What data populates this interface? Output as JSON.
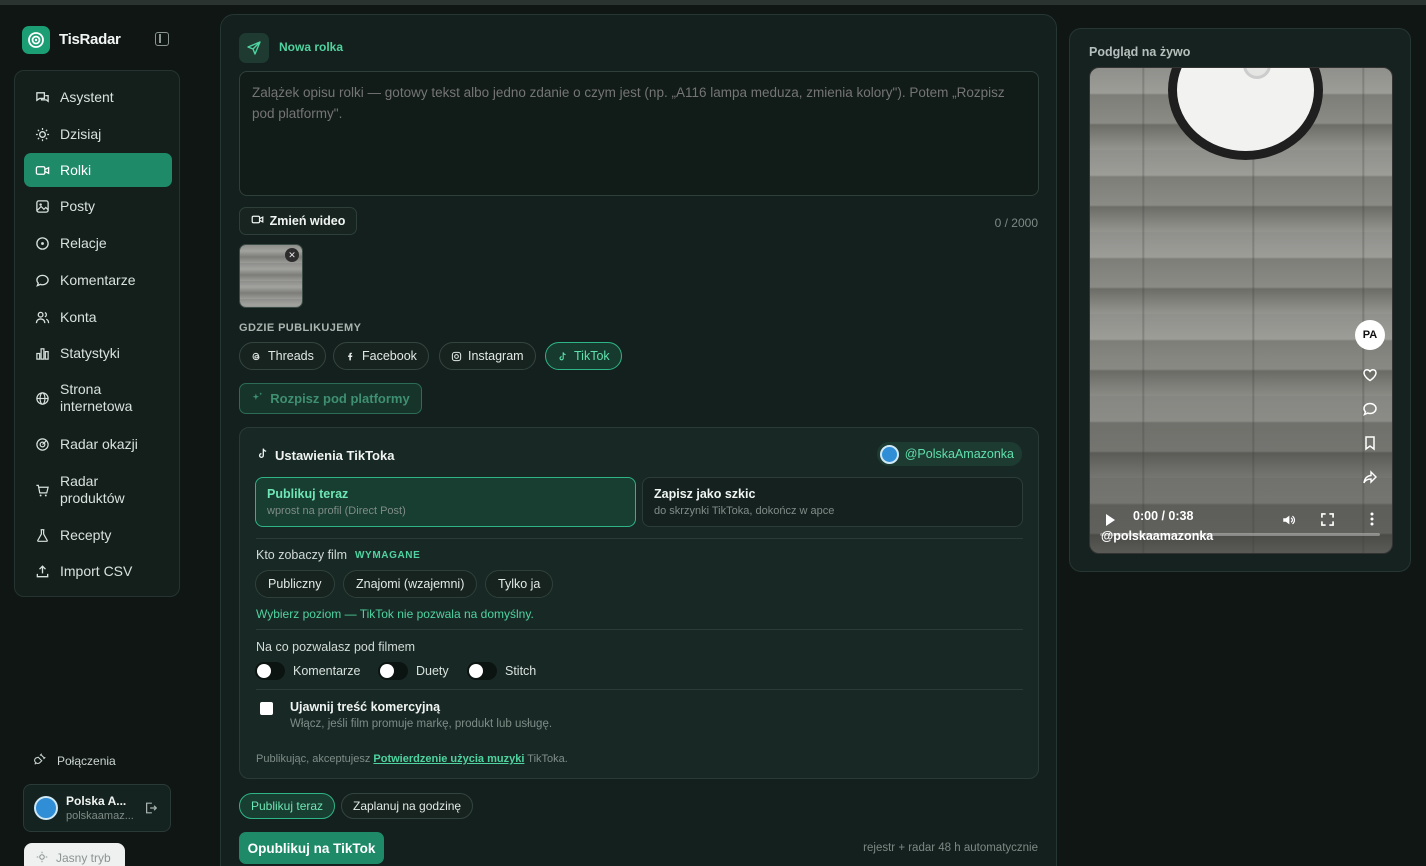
{
  "app": {
    "name": "TisRadar"
  },
  "sidebar": {
    "items": [
      {
        "label": "Asystent",
        "icon": "chat-icon"
      },
      {
        "label": "Dzisiaj",
        "icon": "sun-icon"
      },
      {
        "label": "Rolki",
        "icon": "video-icon",
        "active": true
      },
      {
        "label": "Posty",
        "icon": "image-icon"
      },
      {
        "label": "Relacje",
        "icon": "circle-dot-icon"
      },
      {
        "label": "Komentarze",
        "icon": "comment-icon"
      },
      {
        "label": "Konta",
        "icon": "users-icon"
      },
      {
        "label": "Statystyki",
        "icon": "bar-chart-icon"
      },
      {
        "label": "Strona internetowa",
        "icon": "globe-icon"
      },
      {
        "label": "Radar okazji",
        "icon": "radar-icon"
      },
      {
        "label": "Radar produktów",
        "icon": "cart-icon"
      },
      {
        "label": "Recepty",
        "icon": "flask-icon"
      },
      {
        "label": "Import CSV",
        "icon": "upload-icon"
      }
    ],
    "connections_label": "Połączenia",
    "account": {
      "name": "Polska A...",
      "handle": "polskaamaz..."
    },
    "theme_toggle_label": "Jasny tryb"
  },
  "composer": {
    "title": "Nowa rolka",
    "description_placeholder": "Zalążek opisu rolki — gotowy tekst albo jedno zdanie o czym jest (np. „A116 lampa meduza, zmienia kolory\"). Potem „Rozpisz pod platformy\".",
    "description_value": "",
    "change_video_label": "Zmień wideo",
    "char_counter": "0 / 2000",
    "where_label": "GDZIE PUBLIKUJEMY",
    "platforms": [
      {
        "label": "Threads",
        "selected": false
      },
      {
        "label": "Facebook",
        "selected": false
      },
      {
        "label": "Instagram",
        "selected": false
      },
      {
        "label": "TikTok",
        "selected": true
      }
    ],
    "rewrite_label": "Rozpisz pod platformy"
  },
  "tiktok": {
    "title": "Ustawienia TikToka",
    "account": "@PolskaAmazonka",
    "publish_options": [
      {
        "title": "Publikuj teraz",
        "subtitle": "wprost na profil (Direct Post)",
        "selected": true
      },
      {
        "title": "Zapisz jako szkic",
        "subtitle": "do skrzynki TikToka, dokończ w apce",
        "selected": false
      }
    ],
    "audience_label": "Kto zobaczy film",
    "required_badge": "WYMAGANE",
    "audience_options": [
      "Publiczny",
      "Znajomi (wzajemni)",
      "Tylko ja"
    ],
    "audience_hint": "Wybierz poziom — TikTok nie pozwala na domyślny.",
    "allow_label": "Na co pozwalasz pod filmem",
    "toggles": [
      {
        "label": "Komentarze",
        "on": false
      },
      {
        "label": "Duety",
        "on": false
      },
      {
        "label": "Stitch",
        "on": false
      }
    ],
    "commercial_title": "Ujawnij treść komercyjną",
    "commercial_sub": "Włącz, jeśli film promuje markę, produkt lub usługę.",
    "legal_prefix": "Publikując, akceptujesz",
    "legal_link": "Potwierdzenie użycia muzyki",
    "legal_suffix": "TikToka."
  },
  "schedule": {
    "tabs": [
      {
        "label": "Publikuj teraz",
        "selected": true
      },
      {
        "label": "Zaplanuj na godzinę",
        "selected": false
      }
    ],
    "publish_button": "Opublikuj na TikTok",
    "footnote": "rejestr + radar 48 h automatycznie"
  },
  "preview": {
    "title": "Podgląd na żywo",
    "avatar_initials": "PA",
    "time": "0:00 / 0:38",
    "progress": 0,
    "username": "@polskaamazonka"
  },
  "colors": {
    "accent": "#1e8a68",
    "accent_text": "#4fd3a0",
    "background": "#0f1614"
  }
}
